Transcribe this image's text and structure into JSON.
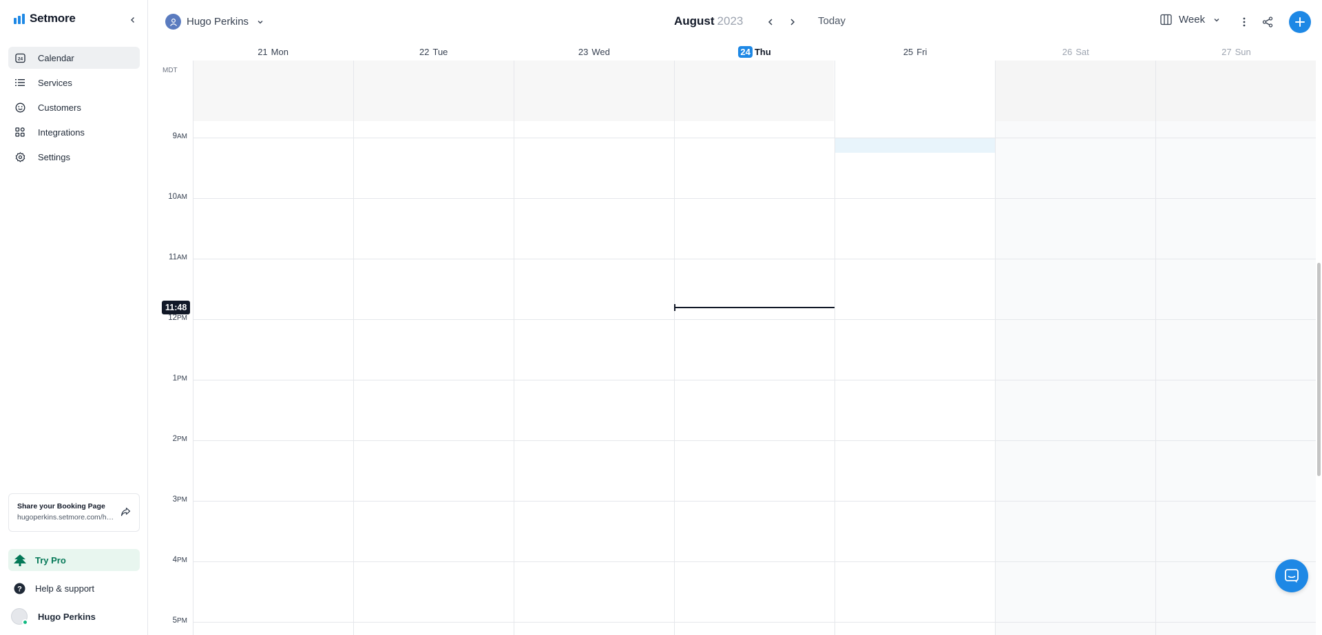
{
  "app": {
    "name": "Setmore"
  },
  "sidebar": {
    "items": [
      {
        "label": "Calendar",
        "icon": "calendar-24-icon",
        "active": true
      },
      {
        "label": "Services",
        "icon": "list-icon"
      },
      {
        "label": "Customers",
        "icon": "smiley-icon"
      },
      {
        "label": "Integrations",
        "icon": "grid-apps-icon"
      },
      {
        "label": "Settings",
        "icon": "gear-icon"
      }
    ],
    "share_card": {
      "title": "Share your Booking Page",
      "url": "hugoperkins.setmore.com/hugo"
    },
    "try_pro": "Try Pro",
    "help": "Help & support",
    "user_name": "Hugo Perkins"
  },
  "header": {
    "staff_name": "Hugo Perkins",
    "month": "August",
    "year": "2023",
    "today_label": "Today",
    "view_label": "Week"
  },
  "calendar": {
    "timezone": "MDT",
    "days": [
      {
        "num": "21",
        "name": "Mon"
      },
      {
        "num": "22",
        "name": "Tue"
      },
      {
        "num": "23",
        "name": "Wed"
      },
      {
        "num": "24",
        "name": "Thu",
        "today": true
      },
      {
        "num": "25",
        "name": "Fri"
      },
      {
        "num": "26",
        "name": "Sat",
        "weekend": true
      },
      {
        "num": "27",
        "name": "Sun",
        "weekend": true
      }
    ],
    "hours": [
      {
        "h": "9",
        "ap": "AM"
      },
      {
        "h": "10",
        "ap": "AM"
      },
      {
        "h": "11",
        "ap": "AM"
      },
      {
        "h": "12",
        "ap": "PM"
      },
      {
        "h": "1",
        "ap": "PM"
      },
      {
        "h": "2",
        "ap": "PM"
      },
      {
        "h": "3",
        "ap": "PM"
      },
      {
        "h": "4",
        "ap": "PM"
      },
      {
        "h": "5",
        "ap": "PM"
      }
    ],
    "current_time": "11:48"
  },
  "colors": {
    "accent": "#1e88e5",
    "pro_green": "#047857"
  }
}
